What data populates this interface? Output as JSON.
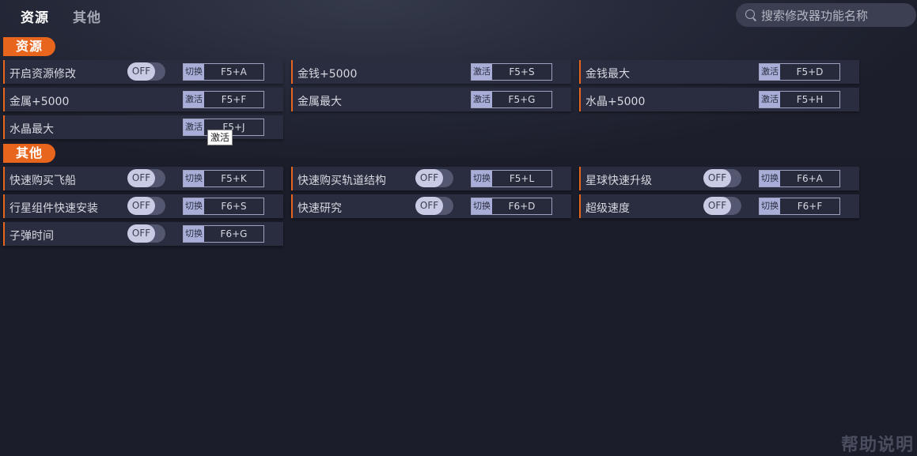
{
  "tabs": [
    {
      "label": "资源"
    },
    {
      "label": "其他"
    }
  ],
  "search": {
    "placeholder": "搜索修改器功能名称"
  },
  "sections": [
    {
      "title": "资源",
      "items": [
        {
          "label": "开启资源修改",
          "toggle": "OFF",
          "mode": "切换",
          "key": "F5+A"
        },
        {
          "label": "金钱+5000",
          "mode": "激活",
          "key": "F5+S"
        },
        {
          "label": "金钱最大",
          "mode": "激活",
          "key": "F5+D"
        },
        {
          "label": "金属+5000",
          "mode": "激活",
          "key": "F5+F"
        },
        {
          "label": "金属最大",
          "mode": "激活",
          "key": "F5+G"
        },
        {
          "label": "水晶+5000",
          "mode": "激活",
          "key": "F5+H"
        },
        {
          "label": "水晶最大",
          "mode": "激活",
          "key": "F5+J"
        }
      ]
    },
    {
      "title": "其他",
      "items": [
        {
          "label": "快速购买飞船",
          "toggle": "OFF",
          "mode": "切换",
          "key": "F5+K"
        },
        {
          "label": "快速购买轨道结构",
          "toggle": "OFF",
          "mode": "切换",
          "key": "F5+L"
        },
        {
          "label": "星球快速升级",
          "toggle": "OFF",
          "mode": "切换",
          "key": "F6+A"
        },
        {
          "label": "行星组件快速安装",
          "toggle": "OFF",
          "mode": "切换",
          "key": "F6+S"
        },
        {
          "label": "快速研究",
          "toggle": "OFF",
          "mode": "切换",
          "key": "F6+D"
        },
        {
          "label": "超级速度",
          "toggle": "OFF",
          "mode": "切换",
          "key": "F6+F"
        },
        {
          "label": "子弹时间",
          "toggle": "OFF",
          "mode": "切换",
          "key": "F6+G"
        }
      ]
    }
  ],
  "tooltip": "激活",
  "help": "帮助说明"
}
